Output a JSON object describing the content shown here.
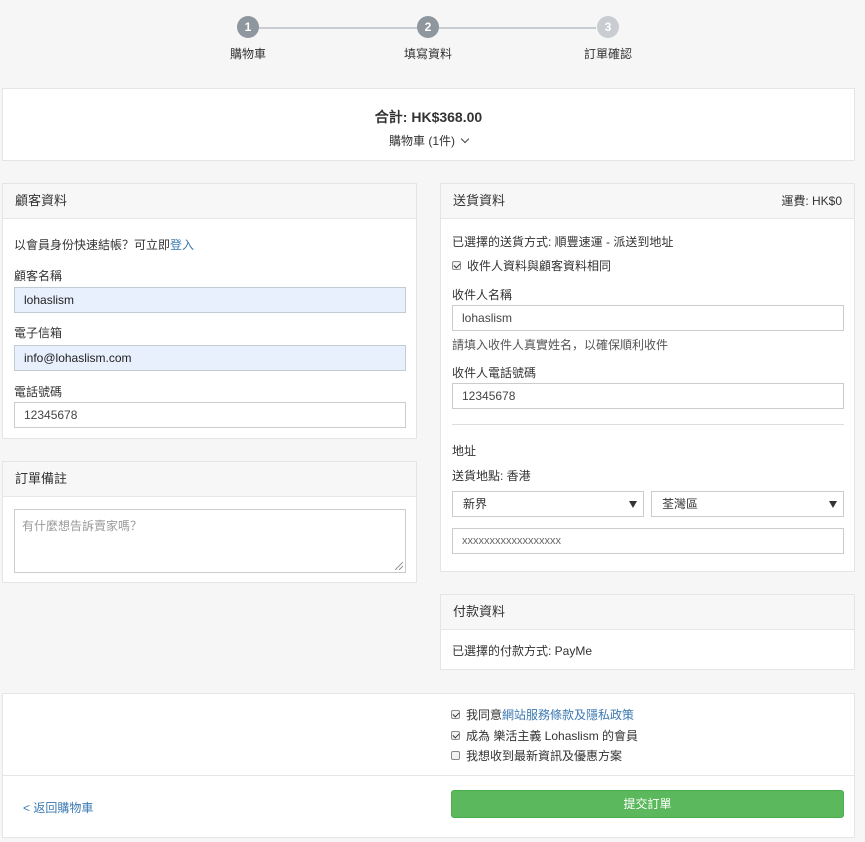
{
  "steps": [
    {
      "number": "1",
      "label": "購物車"
    },
    {
      "number": "2",
      "label": "填寫資料"
    },
    {
      "number": "3",
      "label": "訂單確認"
    }
  ],
  "summary": {
    "total": "合計: HK$368.00",
    "cart_toggle": "購物車 (1件)"
  },
  "customer": {
    "title": "顧客資料",
    "login_prompt": "以會員身份快速結帳？可立即",
    "login_link": "登入",
    "name_label": "顧客名稱",
    "name_value": "lohaslism",
    "email_label": "電子信箱",
    "email_value": "info@lohaslism.com",
    "phone_label": "電話號碼",
    "phone_value": "12345678"
  },
  "remarks": {
    "title": "訂單備註",
    "placeholder": "有什麼想告訴賣家嗎？"
  },
  "delivery": {
    "title": "送貨資料",
    "shipping_fee": "運費: HK$0",
    "method": "已選擇的送貨方式: 順豐速運 - 派送到地址",
    "same_as_customer": "收件人資料與顧客資料相同",
    "recipient_name_label": "收件人名稱",
    "recipient_name_value": "lohaslism",
    "recipient_hint": "請填入收件人真實姓名，以確保順利收件",
    "recipient_phone_label": "收件人電話號碼",
    "recipient_phone_value": "12345678",
    "address_label": "地址",
    "location": "送貨地點: 香港",
    "region_select": "新界",
    "district_select": "荃灣區",
    "address_value": "xxxxxxxxxxxxxxxxxx"
  },
  "payment": {
    "title": "付款資料",
    "method": "已選擇的付款方式: PayMe"
  },
  "agreements": {
    "agree_prefix": "我同意",
    "terms_link": "網站服務條款及隱私政策",
    "member": "成為 樂活主義 Lohaslism 的會員",
    "newsletter": "我想收到最新資訊及優惠方案"
  },
  "actions": {
    "back_link": "< 返回購物車",
    "submit": "提交訂單"
  },
  "colors": {
    "accent": "#5cb85c",
    "link": "#3b79b2",
    "step_active": "#8e969e",
    "step_inactive": "#c9ccd0"
  }
}
